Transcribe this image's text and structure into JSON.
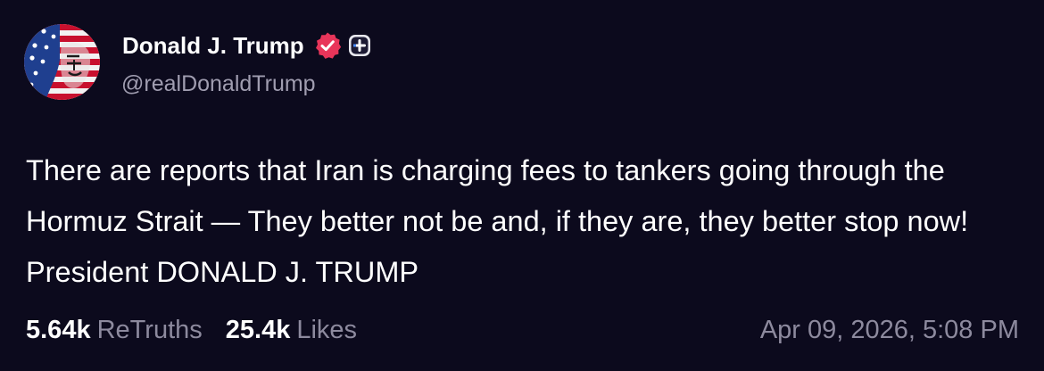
{
  "author": {
    "display_name": "Donald J. Trump",
    "handle": "@realDonaldTrump",
    "avatar_icon": "flag-painted-portrait",
    "verified_icon": "verified-badge-icon",
    "verified_color": "#e8355a",
    "plus_icon": "plus-badge-icon"
  },
  "post": {
    "text": "There are reports that Iran is charging fees to tankers going through the Hormuz Strait — They better not be and, if they are, they better stop now! President DONALD J. TRUMP"
  },
  "stats": {
    "retruths_count": "5.64k",
    "retruths_label": "ReTruths",
    "likes_count": "25.4k",
    "likes_label": "Likes"
  },
  "timestamp": "Apr 09, 2026, 5:08 PM",
  "colors": {
    "background": "#0c0a1d",
    "text_primary": "#ffffff",
    "text_secondary": "#8d8a9e"
  }
}
